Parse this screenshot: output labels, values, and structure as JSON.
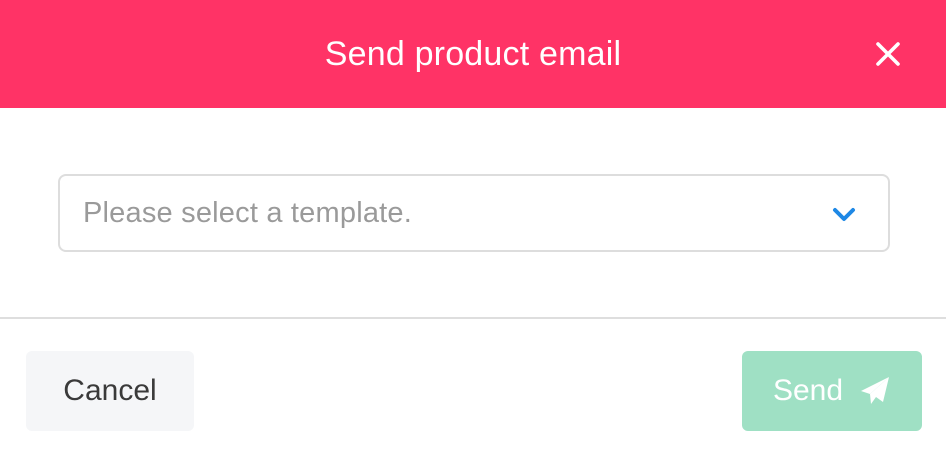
{
  "dialog": {
    "title": "Send product email",
    "close_icon": "close-icon",
    "header_color": "#ff3366"
  },
  "template_select": {
    "placeholder": "Please select a template.",
    "selected_value": "",
    "icon": "chevron-down-icon",
    "icon_color": "#1e88e5"
  },
  "footer": {
    "cancel_label": "Cancel",
    "send_label": "Send",
    "send_icon": "paper-plane-icon",
    "send_color": "#9fe0c4",
    "send_disabled": true
  }
}
